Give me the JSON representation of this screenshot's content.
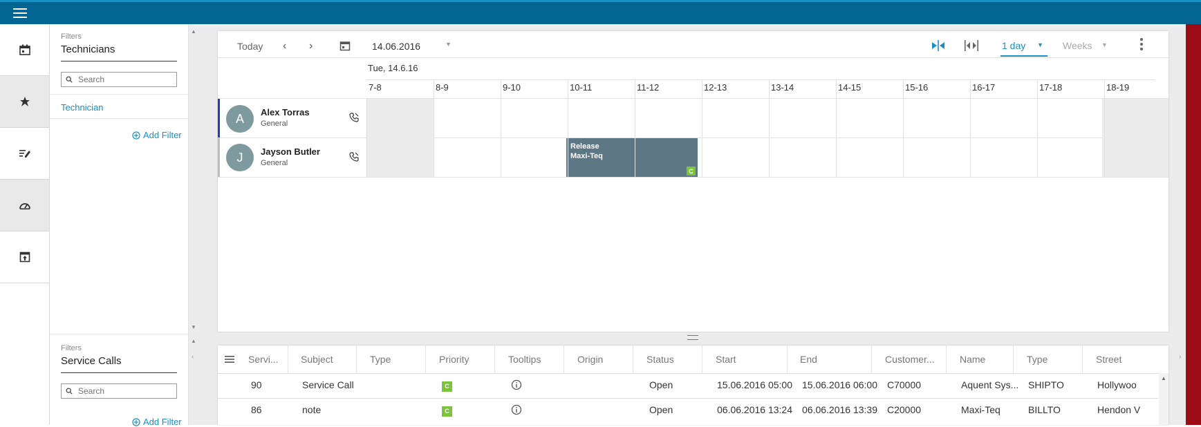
{
  "colors": {
    "header": "#036591",
    "accent": "#1a8fc4",
    "event": "#5d7785",
    "badge": "#7cc43a",
    "right_edge": "#9b0c17"
  },
  "rail": {
    "icons": [
      "calendar-icon",
      "pin-icon",
      "edit-list-icon",
      "dashboard-icon",
      "open-in-icon"
    ]
  },
  "filters_top": {
    "small": "Filters",
    "title": "Technicians",
    "search_placeholder": "Search",
    "item": "Technician",
    "add_filter": "Add Filter"
  },
  "filters_bottom": {
    "small": "Filters",
    "title": "Service Calls",
    "search_placeholder": "Search",
    "add_filter": "Add Filter"
  },
  "toolbar": {
    "today": "Today",
    "date": "14.06.2016",
    "view": "1 day",
    "weeks": "Weeks"
  },
  "day_header": "Tue, 14.6.16",
  "hours": [
    "7-8",
    "8-9",
    "9-10",
    "10-11",
    "11-12",
    "12-13",
    "13-14",
    "14-15",
    "15-16",
    "16-17",
    "17-18",
    "18-19"
  ],
  "technicians": [
    {
      "initial": "A",
      "name": "Alex Torras",
      "group": "General"
    },
    {
      "initial": "J",
      "name": "Jayson Butler",
      "group": "General"
    }
  ],
  "event": {
    "line1": "Release",
    "line2": "Maxi-Teq",
    "badge": "C"
  },
  "grid": {
    "headers": [
      "Servi...",
      "Subject",
      "Type",
      "Priority",
      "Tooltips",
      "Origin",
      "Status",
      "Start",
      "End",
      "Customer...",
      "Name",
      "Type",
      "Street"
    ],
    "rows": [
      {
        "servi": "90",
        "subject": "Service Call",
        "priority": "C",
        "status": "Open",
        "start": "15.06.2016 05:00",
        "end": "15.06.2016 06:00",
        "customer": "C70000",
        "name": "Aquent Sys...",
        "type": "SHIPTO",
        "street": "Hollywoo"
      },
      {
        "servi": "86",
        "subject": "note",
        "priority": "C",
        "status": "Open",
        "start": "06.06.2016 13:24",
        "end": "06.06.2016 13:39",
        "customer": "C20000",
        "name": "Maxi-Teq",
        "type": "BILLTO",
        "street": "Hendon V"
      }
    ]
  }
}
